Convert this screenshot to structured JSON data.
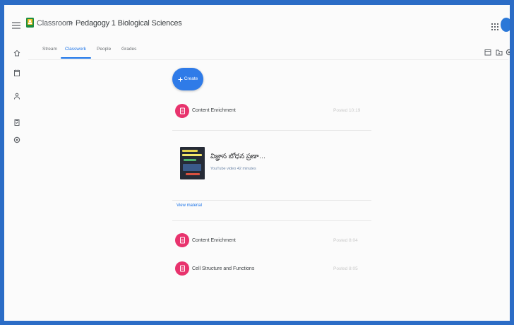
{
  "app": {
    "name": "Classroom",
    "separator": ">",
    "class_name": "Pedagogy 1 Biological Sciences"
  },
  "tabs": [
    {
      "label": "Stream",
      "active": false
    },
    {
      "label": "Classwork",
      "active": true
    },
    {
      "label": "People",
      "active": false
    },
    {
      "label": "Grades",
      "active": false
    }
  ],
  "create": {
    "label": "Create"
  },
  "items": [
    {
      "title": "Content Enrichment",
      "posted": "Posted 10:19"
    },
    {
      "title": "Content Enrichment",
      "posted": "Posted 8:04"
    },
    {
      "title": "Cell Structure and Functions",
      "posted": "Posted 8:05"
    }
  ],
  "material": {
    "title": "విజ్ఞాన బోధన ప్రణాళి...",
    "subtitle": "YouTube video 42 minutes",
    "view_label": "View material"
  },
  "icons": {
    "header": [
      "menu-icon",
      "classroom-logo-icon",
      "apps-grid-icon"
    ],
    "sidebar": [
      "home-icon",
      "calendar-icon",
      "people-icon",
      "todo-icon",
      "settings-icon"
    ],
    "toolbar": [
      "google-calendar-icon",
      "drive-folder-icon",
      "class-settings-icon"
    ],
    "item": "material-icon"
  },
  "colors": {
    "accent": "#1a73e8",
    "item_icon": "#e8336d",
    "frame": "#2b6cc6",
    "logo": "#1e8e3e"
  }
}
